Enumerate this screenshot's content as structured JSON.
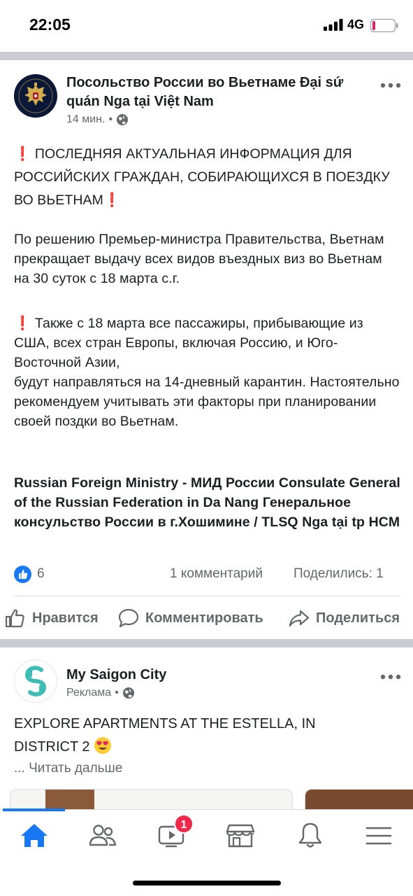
{
  "status_bar": {
    "time": "22:05",
    "network": "4G"
  },
  "post": {
    "author": "Посольство России во Вьетнаме Đại sứ quán Nga tại Việt Nam",
    "time": "14 мин.",
    "separator": "•",
    "privacy_icon": "globe-icon",
    "text": {
      "headline": "ПОСЛЕДНЯЯ АКТУАЛЬНАЯ ИНФОРМАЦИЯ ДЛЯ РОССИЙСКИХ ГРАЖДАН, СОБИРАЮЩИХСЯ В ПОЕЗДКУ ВО ВЬЕТНАМ",
      "paragraph1": "По решению Премьер-министра Правительства, Вьетнам прекращает выдачу всех видов въездных виз во Вьетнам на 30 суток с 18 марта с.г.",
      "paragraph2": "Также с 18 марта все пассажиры, прибывающие из США, всех стран Европы, включая Россию, и Юго-Восточной Азии,\nбудут направляться на 14-дневный карантин. Настоятельно рекомендуем учитывать эти факторы при планировании своей поздки во Вьетнам.",
      "tags": "Russian Foreign Ministry - МИД России Consulate General of the Russian Federation in Da Nang Генеральное консульство России в г.Хошимине / TLSQ Nga tại tp HCM"
    },
    "reactions": {
      "likes": "6",
      "comments": "1 комментарий",
      "shares": "Поделились: 1"
    },
    "actions": {
      "like": "Нравится",
      "comment": "Комментировать",
      "share": "Поделиться"
    }
  },
  "ad": {
    "author": "My Saigon City",
    "label": "Реклама",
    "separator": "•",
    "text": "EXPLORE APARTMENTS AT THE ESTELLA, IN DISTRICT 2",
    "read_more": "... Читать дальше"
  },
  "bottom_nav": {
    "items": [
      "home-icon",
      "friends-icon",
      "watch-icon",
      "marketplace-icon",
      "notifications-icon",
      "menu-icon"
    ],
    "watch_badge": "1"
  },
  "colors": {
    "accent": "#1877f2",
    "badge": "#f02849",
    "secondary_text": "#65676b",
    "separator": "#c9ccd1",
    "emoji_alert": "#e0245e"
  }
}
